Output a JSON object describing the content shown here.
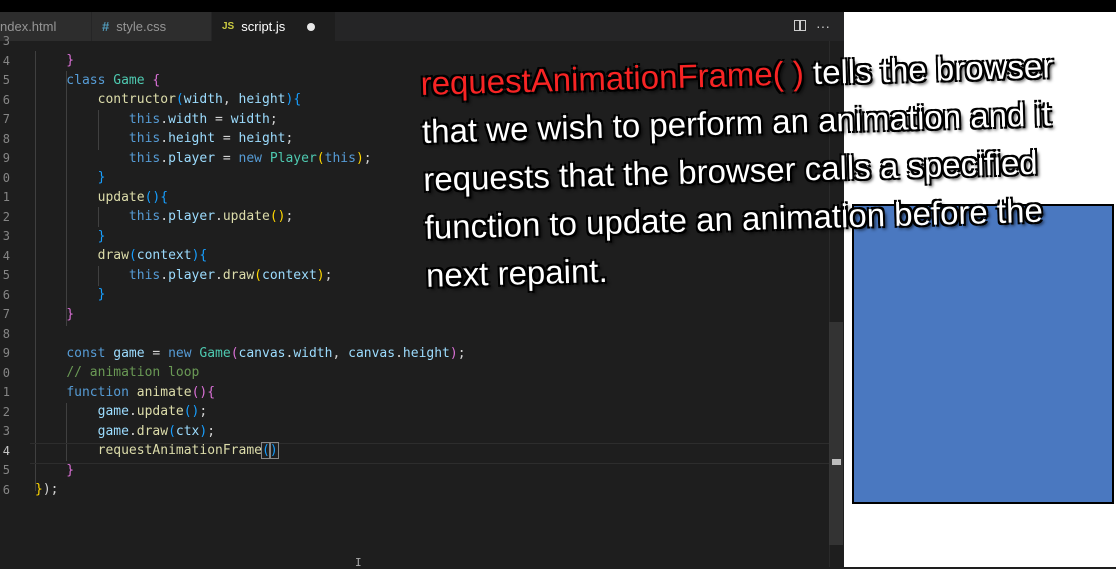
{
  "tabs": [
    {
      "icon": "",
      "label": "ndex.html"
    },
    {
      "icon": "#",
      "label": "style.css"
    },
    {
      "icon": "JS",
      "label": "script.js"
    }
  ],
  "line_numbers": [
    "3",
    "4",
    "5",
    "6",
    "7",
    "8",
    "9",
    "0",
    "1",
    "2",
    "3",
    "4",
    "5",
    "6",
    "7",
    "8",
    "9",
    "0",
    "1",
    "2",
    "3",
    "4",
    "5",
    "6"
  ],
  "overlay": {
    "highlight": "requestAnimationFrame( )",
    "text": " tells the browser that we wish to perform an animation and it requests that the browser calls a specified function to update an animation before the next repaint."
  },
  "colors": {
    "editor_bg": "#1e1e1e",
    "highlight_red": "#f72424",
    "canvas_rect": "#4a78c0"
  }
}
